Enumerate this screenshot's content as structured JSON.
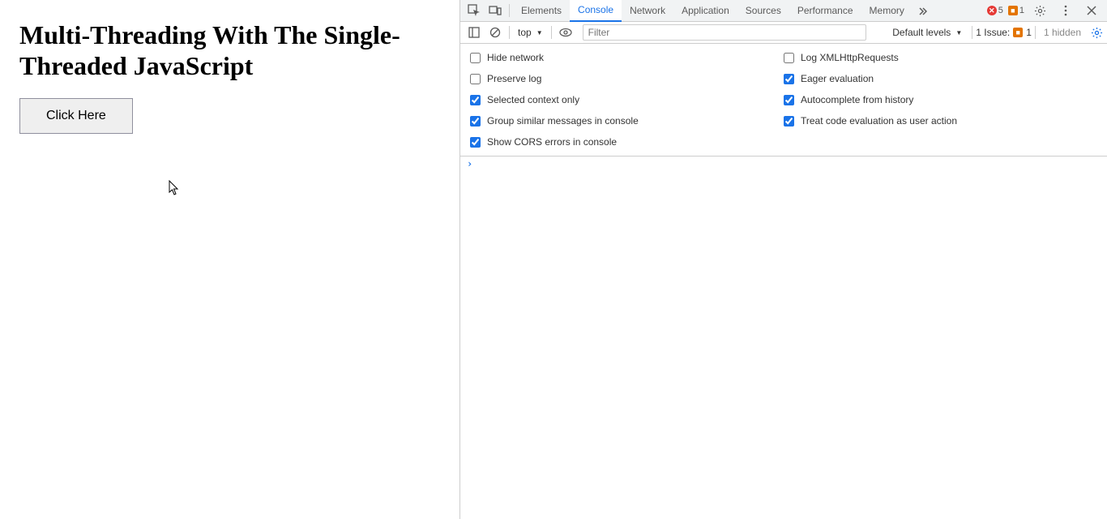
{
  "page": {
    "heading": "Multi-Threading With The Single-Threaded JavaScript",
    "button_label": "Click Here"
  },
  "devtools": {
    "tabs": [
      "Elements",
      "Console",
      "Network",
      "Application",
      "Sources",
      "Performance",
      "Memory"
    ],
    "active_tab": "Console",
    "errors_count": "5",
    "warnings_count": "1",
    "toolbar": {
      "context": "top",
      "filter_placeholder": "Filter",
      "levels_label": "Default levels",
      "issue_label": "1 Issue:",
      "issue_count": "1",
      "hidden_label": "1 hidden"
    },
    "settings_left": [
      {
        "label": "Hide network",
        "checked": false
      },
      {
        "label": "Preserve log",
        "checked": false
      },
      {
        "label": "Selected context only",
        "checked": true
      },
      {
        "label": "Group similar messages in console",
        "checked": true
      },
      {
        "label": "Show CORS errors in console",
        "checked": true
      }
    ],
    "settings_right": [
      {
        "label": "Log XMLHttpRequests",
        "checked": false
      },
      {
        "label": "Eager evaluation",
        "checked": true
      },
      {
        "label": "Autocomplete from history",
        "checked": true
      },
      {
        "label": "Treat code evaluation as user action",
        "checked": true
      }
    ],
    "prompt": "›"
  }
}
